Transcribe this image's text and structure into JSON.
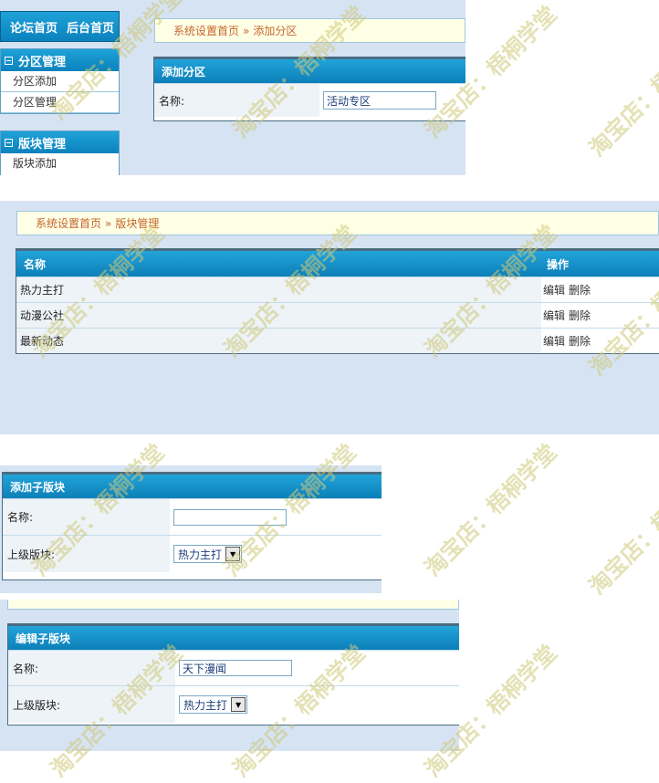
{
  "panel1": {
    "top_links": [
      "论坛首页",
      "后台首页"
    ],
    "menu_sections": [
      {
        "title": "分区管理",
        "items": [
          "分区添加",
          "分区管理"
        ]
      },
      {
        "title": "版块管理",
        "items": [
          "版块添加"
        ]
      }
    ],
    "breadcrumb": {
      "home": "系统设置首页",
      "sep": "»",
      "current": "添加分区"
    },
    "form": {
      "title": "添加分区",
      "name_label": "名称:",
      "name_value": "活动专区"
    }
  },
  "panel2": {
    "breadcrumb": {
      "home": "系统设置首页",
      "sep": "»",
      "current": "版块管理"
    },
    "table": {
      "columns": [
        "名称",
        "操作"
      ],
      "rows": [
        {
          "name": "热力主打",
          "edit": "编辑",
          "delete": "删除"
        },
        {
          "name": "动漫公社",
          "edit": "编辑",
          "delete": "删除"
        },
        {
          "name": "最新动态",
          "edit": "编辑",
          "delete": "删除"
        }
      ]
    }
  },
  "panel3": {
    "form": {
      "title": "添加子版块",
      "name_label": "名称:",
      "name_value": "",
      "parent_label": "上级版块:",
      "parent_value": "热力主打"
    }
  },
  "panel4": {
    "form": {
      "title": "编辑子版块",
      "name_label": "名称:",
      "name_value": "天下漫闻",
      "parent_label": "上级版块:",
      "parent_value": "热力主打"
    }
  },
  "watermark": "淘宝店：梧桐学堂"
}
